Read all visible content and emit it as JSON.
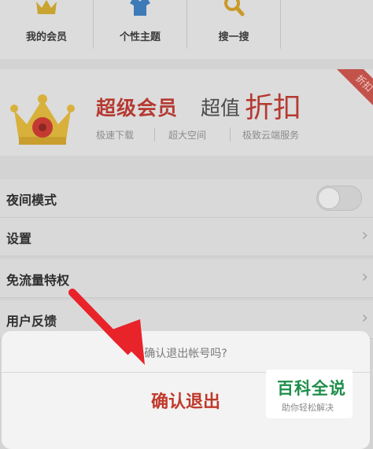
{
  "top_menu": [
    {
      "label": "我的会员",
      "icon": "crown-icon"
    },
    {
      "label": "个性主题",
      "icon": "shirt-icon"
    },
    {
      "label": "搜一搜",
      "icon": "search-icon"
    }
  ],
  "banner": {
    "title_strong": "超级会员",
    "title_plain": "超值",
    "title_big": "折扣",
    "ribbon": "折扣",
    "features": [
      "极速下载",
      "超大空间",
      "极致云端服务"
    ],
    "icon": "crown-icon"
  },
  "settings": [
    {
      "label": "夜间模式",
      "control": "toggle",
      "on": false
    },
    {
      "label": "设置",
      "control": "chevron"
    },
    {
      "label": "免流量特权",
      "control": "chevron"
    },
    {
      "label": "用户反馈",
      "control": "chevron"
    }
  ],
  "dialog": {
    "question": "确认退出帐号吗?",
    "confirm": "确认退出"
  },
  "watermark": {
    "title": "百科全说",
    "subtitle": "助你轻松解决"
  },
  "colors": {
    "accent_red": "#b53a32",
    "confirm_red": "#c0392b",
    "watermark_green": "#1e8e4a",
    "annotation_arrow": "#e8232a"
  }
}
